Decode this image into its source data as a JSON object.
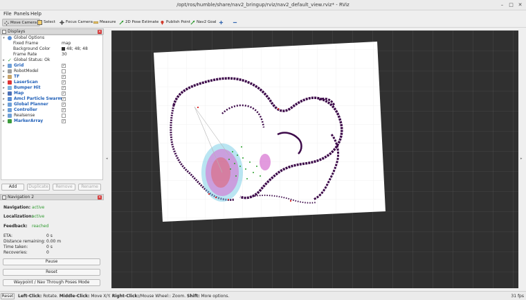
{
  "window": {
    "title": "/opt/ros/humble/share/nav2_bringup/rviz/nav2_default_view.rviz* - RViz",
    "minimize": "–",
    "maximize": "□",
    "close": "✕"
  },
  "menu": {
    "file": "File",
    "panels": "Panels",
    "help": "Help"
  },
  "toolbar": {
    "move_camera": "Move Camera",
    "select": "Select",
    "focus_camera": "Focus Camera",
    "measure": "Measure",
    "pose_estimate": "2D Pose Estimate",
    "publish_point": "Publish Point",
    "nav2_goal": "Nav2 Goal"
  },
  "displays": {
    "title": "Displays",
    "rows": [
      {
        "label": "Global Options",
        "value": ""
      },
      {
        "label": "Fixed Frame",
        "value": "map"
      },
      {
        "label": "Background Color",
        "value": "48; 48; 48"
      },
      {
        "label": "Frame Rate",
        "value": "30"
      },
      {
        "label": "Global Status: Ok",
        "value": ""
      },
      {
        "label": "Grid"
      },
      {
        "label": "RobotModel"
      },
      {
        "label": "TF"
      },
      {
        "label": "LaserScan"
      },
      {
        "label": "Bumper Hit"
      },
      {
        "label": "Map"
      },
      {
        "label": "Amcl Particle Swarm"
      },
      {
        "label": "Global Planner"
      },
      {
        "label": "Controller"
      },
      {
        "label": "Realsense"
      },
      {
        "label": "MarkerArray"
      }
    ],
    "checked": [
      true,
      false,
      true,
      true,
      true,
      true,
      true,
      true,
      true,
      false,
      true
    ],
    "buttons": {
      "add": "Add",
      "duplicate": "Duplicate",
      "remove": "Remove",
      "rename": "Rename"
    }
  },
  "navigation": {
    "title": "Navigation 2",
    "navigation_label": "Navigation:",
    "navigation_value": "active",
    "localization_label": "Localization:",
    "localization_value": "active",
    "feedback_label": "Feedback:",
    "feedback_value": "reached",
    "eta_label": "ETA:",
    "eta_value": "0 s",
    "distance_label": "Distance remaining:",
    "distance_value": "0.00 m",
    "time_label": "Time taken:",
    "time_value": "0 s",
    "recoveries_label": "Recoveries:",
    "recoveries_value": "0",
    "pause": "Pause",
    "reset": "Reset",
    "waypoint_mode": "Waypoint / Nav Through Poses Mode"
  },
  "status": {
    "reset": "Reset",
    "hint_bold1": "Left-Click:",
    "hint1": " Rotate. ",
    "hint_bold2": "Middle-Click:",
    "hint2": " Move X/Y. ",
    "hint_bold3": "Right-Click:",
    "hint3": "/Mouse Wheel:: Zoom. ",
    "hint_bold4": "Shift:",
    "hint4": " More options.",
    "fps": "31 fps"
  },
  "colors": {
    "background": "#303030",
    "map": "#ffffff",
    "obstacle": "#3d0a4a",
    "particles": "#2ca02c"
  }
}
